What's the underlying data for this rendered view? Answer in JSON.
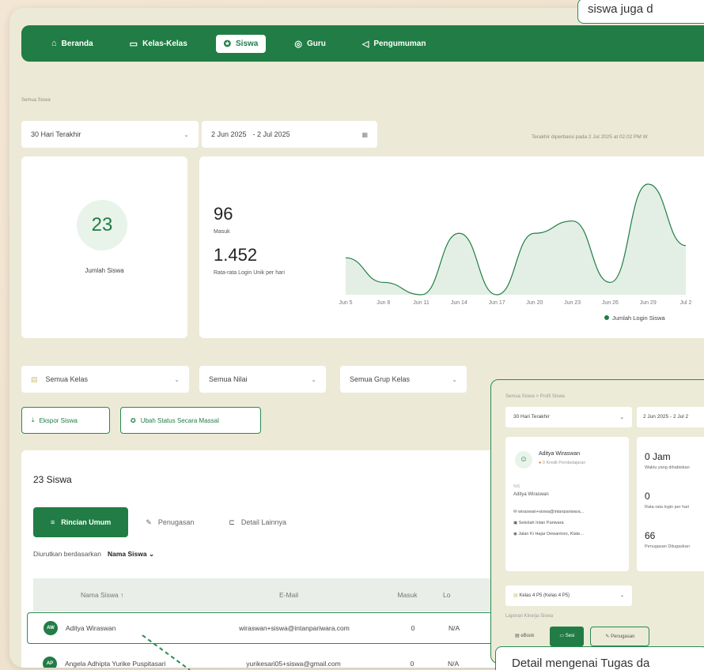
{
  "nav": {
    "items": [
      {
        "label": "Beranda",
        "icon": "home-icon",
        "glyph": "⌂",
        "active": false
      },
      {
        "label": "Kelas-Kelas",
        "icon": "book-icon",
        "glyph": "▭",
        "active": false
      },
      {
        "label": "Siswa",
        "icon": "student-icon",
        "glyph": "✪",
        "active": true
      },
      {
        "label": "Guru",
        "icon": "teacher-icon",
        "glyph": "◎",
        "active": false
      },
      {
        "label": "Pengumuman",
        "icon": "megaphone-icon",
        "glyph": "◁",
        "active": false
      }
    ]
  },
  "breadcrumb": "Semua Siswa",
  "filters": {
    "range": "30 Hari Terakhir",
    "date_from": "2 Jun 2025",
    "date_to": "- 2 Jul 2025",
    "updated": "Terakhir diperbarui pada 2 Jul 2025 at 02.02 PM W"
  },
  "summary": {
    "count": "23",
    "count_label": "Jumlah Siswa",
    "logins": "96",
    "logins_label": "Masuk",
    "avg": "1.452",
    "avg_label": "Rata-rata Login Unik per hari"
  },
  "chart_data": {
    "type": "area",
    "x": [
      "Jun 5",
      "Jun 8",
      "Jun 11",
      "Jun 14",
      "Jun 17",
      "Jun 20",
      "Jun 23",
      "Jun 26",
      "Jun 29",
      "Jul 2"
    ],
    "series": [
      {
        "name": "Jumlah Login Siswa",
        "values": [
          3,
          1,
          0,
          5,
          0,
          5,
          6,
          1,
          9,
          4
        ]
      }
    ],
    "legend": "bottom-right",
    "color": "#217d45"
  },
  "filters2": {
    "kelas": "Semua Kelas",
    "nilai": "Semua Nilai",
    "grup": "Semua Grup Kelas"
  },
  "actions": {
    "export": "Ekspor Siswa",
    "bulk": "Ubah Status Secara Massal"
  },
  "list": {
    "title": "23 Siswa",
    "tabs": [
      "Rincian Umum",
      "Penugasan",
      "Detail Lainnya"
    ],
    "sort_label": "Diurutkan berdasarkan",
    "sort_value": "Nama Siswa",
    "columns": [
      "Nama Siswa",
      "E-Mail",
      "Masuk",
      "Lo"
    ],
    "rows": [
      {
        "initials": "AW",
        "name": "Aditya Wiraswan",
        "email": "wiraswan+siswa@intanpariwara.com",
        "masuk": "0",
        "last": "N/A"
      },
      {
        "initials": "AP",
        "name": "Angela Adhipta Yurike Puspitasari",
        "email": "yurikesari05+siswa@gmail.com",
        "masuk": "0",
        "last": "N/A"
      }
    ]
  },
  "callouts": {
    "top": "siswa juga d",
    "bottom": "Detail mengenai Tugas da"
  },
  "inset": {
    "crumb": "Semua Siswa  >  Profil Siswa",
    "range": "30 Hari Terakhir",
    "date": "2 Jun 2025  - 2 Jul 2",
    "name": "Aditya Wiraswan",
    "credit": "0 Kredit Pembelajaran",
    "nisn_label": "NIS",
    "nisn_val": "Aditya Wiraswan",
    "email": "wiraswan+siswa@intanpariwara...",
    "school": "Sekolah Intan Pariwara",
    "address": "Jalan Ki Hajar Dewantoro, Klate...",
    "stat1": "0 Jam",
    "stat1_label": "Waktu yang dihabiskan",
    "stat2": "0",
    "stat2_label": "Rata-rata login per hari",
    "stat3": "66",
    "stat3_label": "Penugasan Ditugaskan",
    "class": "Kelas 4 P5 (Kelas 4 P5)",
    "section": "Laporan Kinerja Siswa",
    "tabs": [
      "eBook",
      "Sesi",
      "Penugasan"
    ]
  }
}
